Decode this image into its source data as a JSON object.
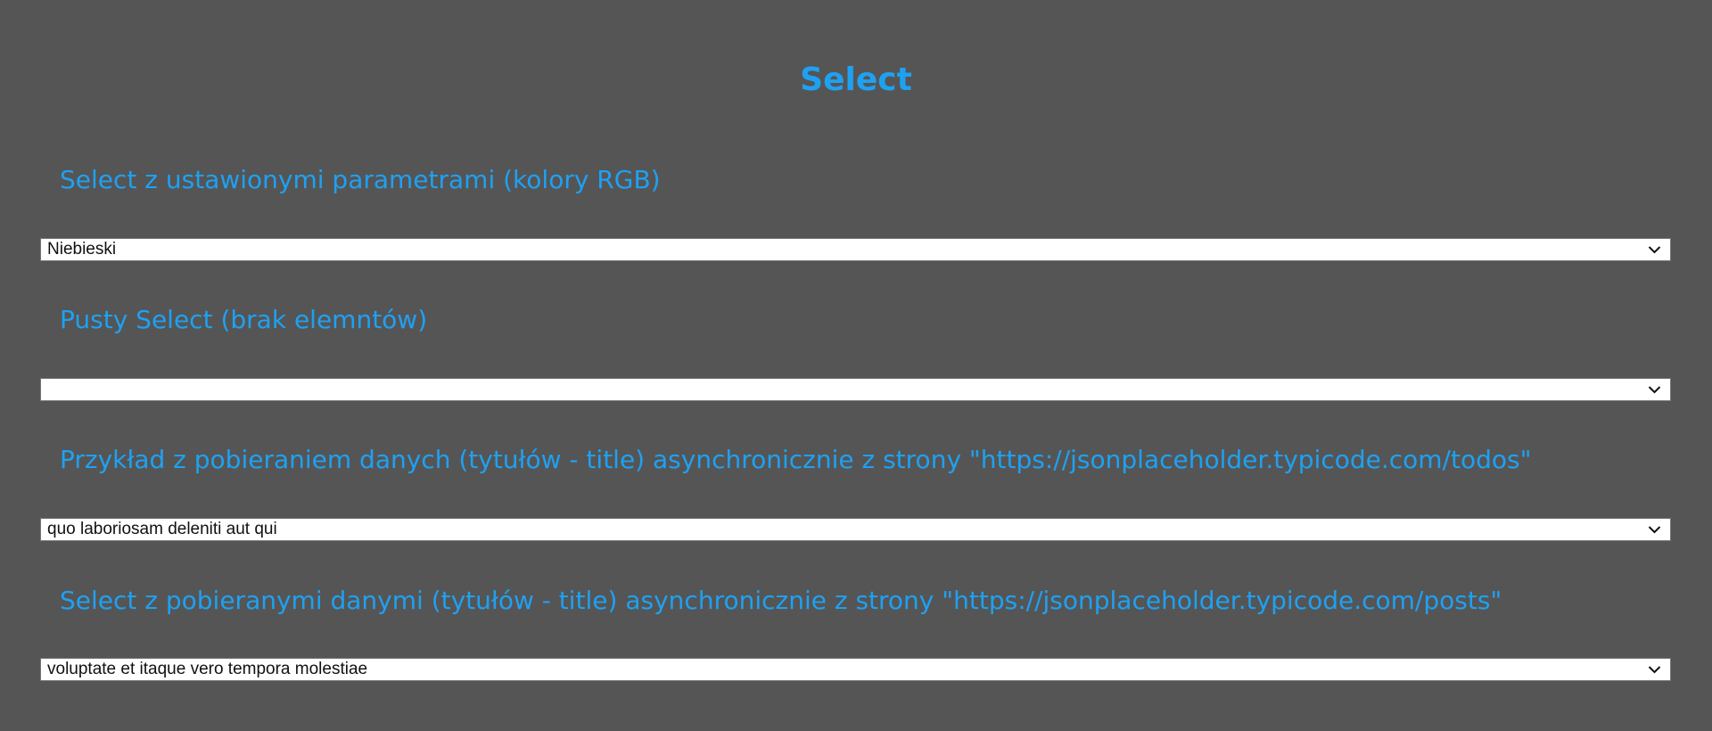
{
  "page": {
    "title": "Select"
  },
  "sections": [
    {
      "heading": "Select z ustawionymi parametrami (kolory RGB)",
      "selected_value": "Niebieski"
    },
    {
      "heading": "Pusty Select (brak elemntów)",
      "selected_value": ""
    },
    {
      "heading": "Przykład z pobieraniem danych (tytułów - title) asynchronicznie z strony \"https://jsonplaceholder.typicode.com/todos\"",
      "selected_value": "quo laboriosam deleniti aut qui"
    },
    {
      "heading": "Select z pobieranymi danymi (tytułów - title) asynchronicznie z strony \"https://jsonplaceholder.typicode.com/posts\"",
      "selected_value": "voluptate et itaque vero tempora molestiae"
    }
  ],
  "icons": {
    "dropdown": "chevron-down-icon"
  },
  "colors": {
    "background": "#555555",
    "accent": "#1ea1f2",
    "select_background": "#ffffff",
    "select_text": "#111111"
  }
}
